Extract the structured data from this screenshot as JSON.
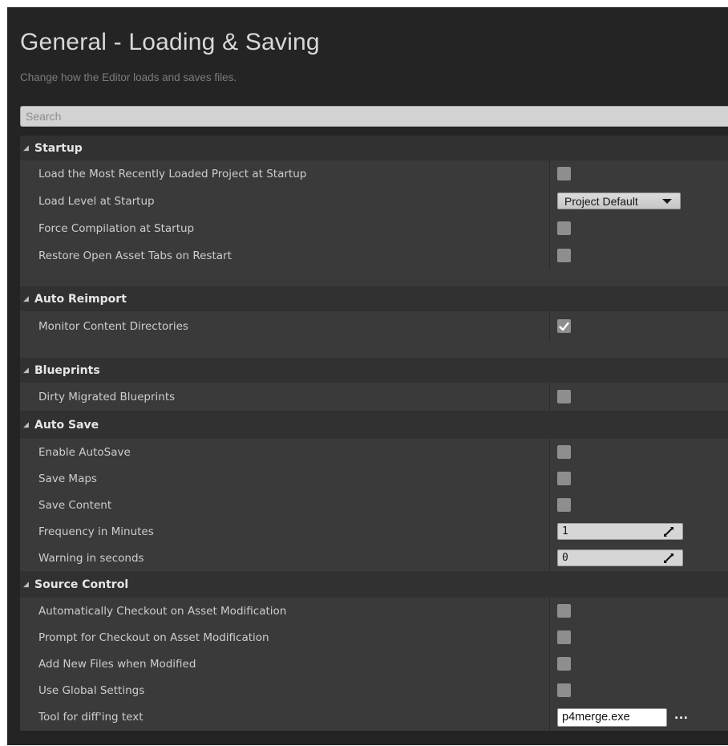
{
  "page": {
    "title": "General - Loading & Saving",
    "subtitle": "Change how the Editor loads and saves files."
  },
  "search": {
    "placeholder": "Search"
  },
  "categories": {
    "startup": {
      "title": "Startup",
      "rows": {
        "load_recent_project": {
          "label": "Load the Most Recently Loaded Project at Startup",
          "checked": false
        },
        "load_level": {
          "label": "Load Level at Startup",
          "value": "Project Default"
        },
        "force_compilation": {
          "label": "Force Compilation at Startup",
          "checked": false
        },
        "restore_tabs": {
          "label": "Restore Open Asset Tabs on Restart",
          "checked": false
        }
      }
    },
    "auto_reimport": {
      "title": "Auto Reimport",
      "rows": {
        "monitor_content": {
          "label": "Monitor Content Directories",
          "checked": true
        }
      }
    },
    "blueprints": {
      "title": "Blueprints",
      "rows": {
        "dirty_migrated": {
          "label": "Dirty Migrated Blueprints",
          "checked": false
        }
      }
    },
    "auto_save": {
      "title": "Auto Save",
      "rows": {
        "enable_autosave": {
          "label": "Enable AutoSave",
          "checked": false
        },
        "save_maps": {
          "label": "Save Maps",
          "checked": false
        },
        "save_content": {
          "label": "Save Content",
          "checked": false
        },
        "frequency": {
          "label": "Frequency in Minutes",
          "value": "1"
        },
        "warning": {
          "label": "Warning in seconds",
          "value": "0"
        }
      }
    },
    "source_control": {
      "title": "Source Control",
      "rows": {
        "auto_checkout": {
          "label": "Automatically Checkout on Asset Modification",
          "checked": false
        },
        "prompt_checkout": {
          "label": "Prompt for Checkout on Asset Modification",
          "checked": false
        },
        "add_new_files": {
          "label": "Add New Files when Modified",
          "checked": false
        },
        "use_global": {
          "label": "Use Global Settings",
          "checked": false
        },
        "diff_tool": {
          "label": "Tool for diff'ing text",
          "value": "p4merge.exe",
          "browse_label": "..."
        }
      }
    }
  },
  "icons": {
    "collapse": "collapse-triangle-icon",
    "checkmark": "checkmark-icon",
    "dropdown": "dropdown-caret-icon",
    "drag": "drag-arrows-icon"
  },
  "colors": {
    "background": "#242424",
    "row": "#3a3a3a",
    "header": "#313131",
    "checkbox": "#8e8e8e"
  }
}
